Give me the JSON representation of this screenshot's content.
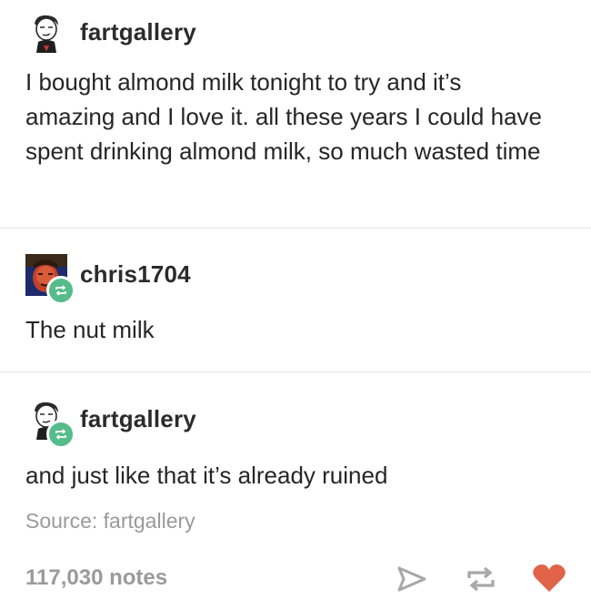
{
  "posts": [
    {
      "username": "fartgallery",
      "text": "I bought almond milk tonight to try and it’s amazing and I love it. all these years I could have spent drinking almond milk, so much wasted time"
    },
    {
      "username": "chris1704",
      "text": "The nut milk"
    },
    {
      "username": "fartgallery",
      "text": "and just like that it’s already ruined"
    }
  ],
  "footer": {
    "source": "Source: fartgallery",
    "notes": "117,030 notes"
  },
  "icons": {
    "avatar_fartgallery": "cartoon-face-avatar",
    "avatar_chris1704": "photo-avatar",
    "reblog_badge": "reblog-icon",
    "share": "share-arrow-icon",
    "reblog": "reblog-icon",
    "like": "heart-icon"
  },
  "colors": {
    "reblog_green": "#56bc8a",
    "heart": "#e1634a",
    "muted": "#9a9a9a"
  }
}
